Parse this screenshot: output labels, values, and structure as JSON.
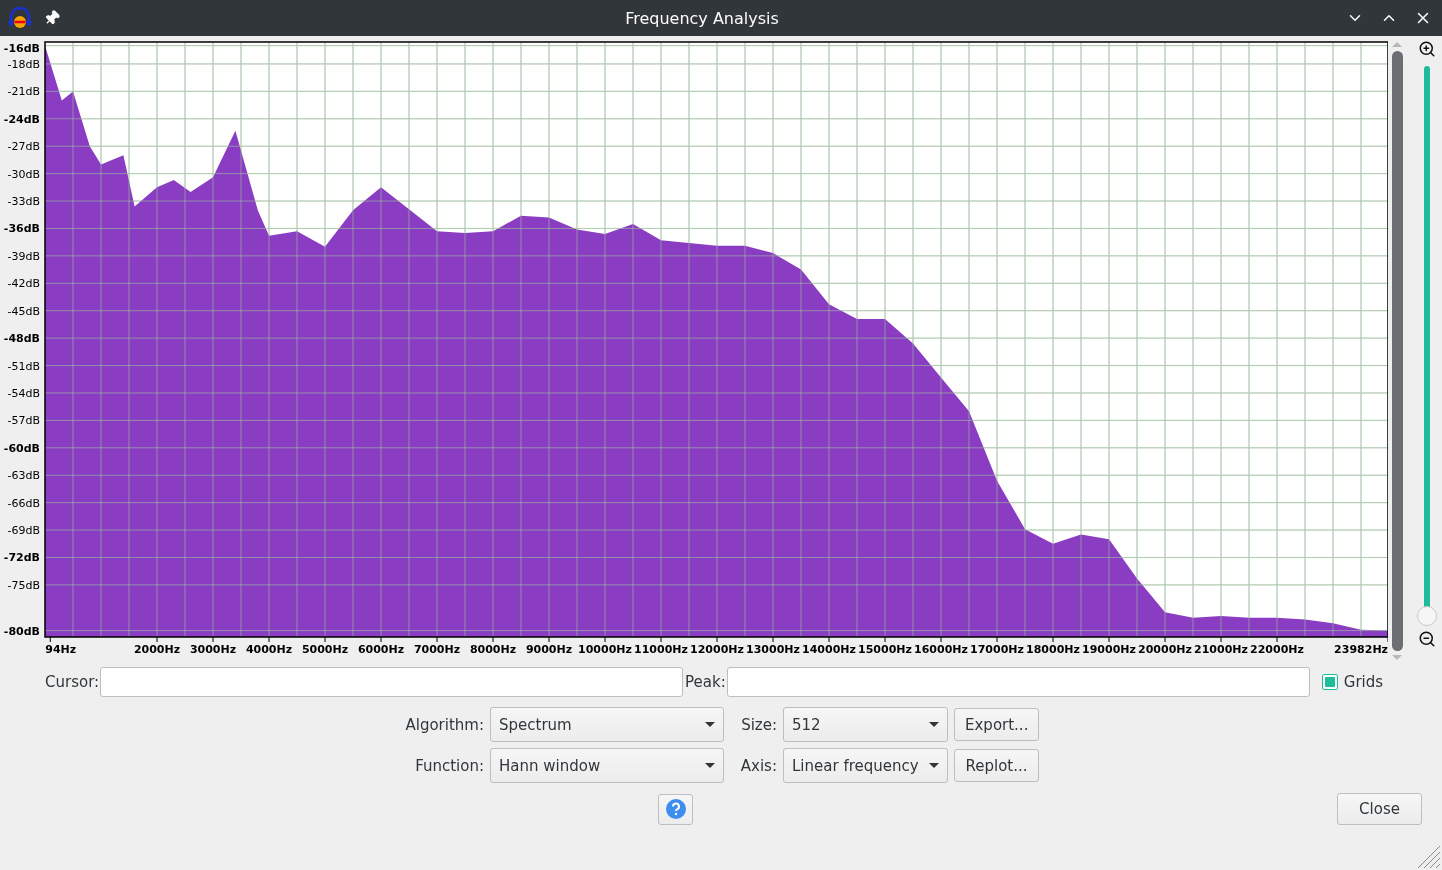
{
  "window": {
    "title": "Frequency Analysis"
  },
  "chart": {
    "chart_data": {
      "type": "area",
      "grid": true,
      "x": [
        0,
        300,
        500,
        800,
        1000,
        1400,
        1600,
        2000,
        2300,
        2600,
        3000,
        3400,
        3800,
        4000,
        4500,
        5000,
        5500,
        6000,
        6500,
        7000,
        7500,
        8000,
        8500,
        9000,
        9500,
        10000,
        10500,
        11000,
        11500,
        12000,
        12500,
        13000,
        13500,
        14000,
        14500,
        15000,
        15500,
        16000,
        16500,
        17000,
        17500,
        18000,
        18500,
        19000,
        19500,
        20000,
        20500,
        21000,
        21500,
        22000,
        22500,
        23000,
        23500,
        23982
      ],
      "series": [
        {
          "color": "#8a3cc2",
          "values": [
            -16,
            -22,
            -21,
            -27,
            -29,
            -28,
            -33.6,
            -31.5,
            -30.7,
            -32,
            -30.4,
            -25.3,
            -34,
            -36.8,
            -36.3,
            -38,
            -34,
            -31.5,
            -33.9,
            -36.3,
            -36.5,
            -36.3,
            -34.6,
            -34.8,
            -36.1,
            -36.6,
            -35.5,
            -37.3,
            -37.6,
            -37.9,
            -37.9,
            -38.7,
            -40.5,
            -44.3,
            -45.9,
            -45.9,
            -48.6,
            -52.3,
            -56,
            -63.6,
            -68.9,
            -70.5,
            -69.5,
            -70,
            -74.3,
            -78,
            -78.6,
            -78.4,
            -78.6,
            -78.6,
            -78.8,
            -79.2,
            -79.9,
            -80
          ]
        }
      ],
      "xlim": [
        0,
        23982
      ],
      "ylim": [
        -80.7,
        -15.6
      ],
      "xticks": [
        {
          "value": 94,
          "label": "94Hz"
        },
        {
          "value": 2000,
          "label": "2000Hz"
        },
        {
          "value": 3000,
          "label": "3000Hz"
        },
        {
          "value": 4000,
          "label": "4000Hz"
        },
        {
          "value": 5000,
          "label": "5000Hz"
        },
        {
          "value": 6000,
          "label": "6000Hz"
        },
        {
          "value": 7000,
          "label": "7000Hz"
        },
        {
          "value": 8000,
          "label": "8000Hz"
        },
        {
          "value": 9000,
          "label": "9000Hz"
        },
        {
          "value": 10000,
          "label": "10000Hz"
        },
        {
          "value": 11000,
          "label": "11000Hz"
        },
        {
          "value": 12000,
          "label": "12000Hz"
        },
        {
          "value": 13000,
          "label": "13000Hz"
        },
        {
          "value": 14000,
          "label": "14000Hz"
        },
        {
          "value": 15000,
          "label": "15000Hz"
        },
        {
          "value": 16000,
          "label": "16000Hz"
        },
        {
          "value": 17000,
          "label": "17000Hz"
        },
        {
          "value": 18000,
          "label": "18000Hz"
        },
        {
          "value": 19000,
          "label": "19000Hz"
        },
        {
          "value": 20000,
          "label": "20000Hz"
        },
        {
          "value": 21000,
          "label": "21000Hz"
        },
        {
          "value": 22000,
          "label": "22000Hz"
        },
        {
          "value": 23982,
          "label": "23982Hz"
        }
      ],
      "yticks": [
        {
          "value": -16,
          "label": "-16dB"
        },
        {
          "value": -18,
          "label": "-18dB"
        },
        {
          "value": -21,
          "label": "-21dB"
        },
        {
          "value": -24,
          "label": "-24dB"
        },
        {
          "value": -27,
          "label": "-27dB"
        },
        {
          "value": -30,
          "label": "-30dB"
        },
        {
          "value": -33,
          "label": "-33dB"
        },
        {
          "value": -36,
          "label": "-36dB"
        },
        {
          "value": -39,
          "label": "-39dB"
        },
        {
          "value": -42,
          "label": "-42dB"
        },
        {
          "value": -45,
          "label": "-45dB"
        },
        {
          "value": -48,
          "label": "-48dB"
        },
        {
          "value": -51,
          "label": "-51dB"
        },
        {
          "value": -54,
          "label": "-54dB"
        },
        {
          "value": -57,
          "label": "-57dB"
        },
        {
          "value": -60,
          "label": "-60dB"
        },
        {
          "value": -63,
          "label": "-63dB"
        },
        {
          "value": -66,
          "label": "-66dB"
        },
        {
          "value": -69,
          "label": "-69dB"
        },
        {
          "value": -72,
          "label": "-72dB"
        },
        {
          "value": -75,
          "label": "-75dB"
        },
        {
          "value": -80,
          "label": "-80dB"
        }
      ]
    }
  },
  "zoom_slider": {
    "level": 0
  },
  "cursor": {
    "label": "Cursor:"
  },
  "peak": {
    "label": "Peak:"
  },
  "grids": {
    "label": "Grids",
    "checked": true
  },
  "algorithm": {
    "label": "Algorithm:",
    "value": "Spectrum"
  },
  "size": {
    "label": "Size:",
    "value": "512"
  },
  "export_button": "Export...",
  "function": {
    "label": "Function:",
    "value": "Hann window"
  },
  "axis": {
    "label": "Axis:",
    "value": "Linear frequency"
  },
  "replot_button": "Replot...",
  "close_button": "Close"
}
